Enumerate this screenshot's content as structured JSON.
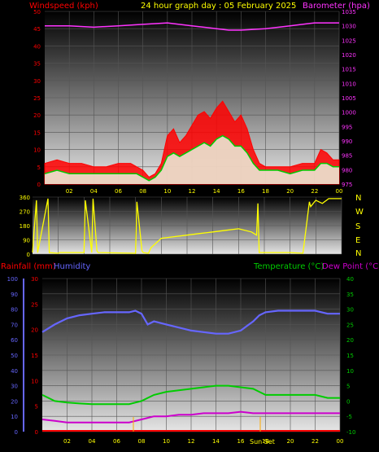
{
  "header": {
    "windspeed_label": "Windspeed (kph)",
    "title": "24 hour graph day : 05 February 2025",
    "barometer_label": "Barometer (hpa)"
  },
  "lower_header": {
    "rain_label": "Rainfall (mm)",
    "humidity_label": "Humidity",
    "temp_label": "Temperature (°C)",
    "dew_label": "Dew Point (°C)"
  },
  "compass": [
    "N",
    "W",
    "S",
    "E",
    "N"
  ],
  "sun_label": "Sun Set",
  "colors": {
    "windspeed": "#ff0000",
    "wind_avg": "#00cc00",
    "gust": "#e8ffe8",
    "barometer": "#ff33ff",
    "direction": "#ffff00",
    "humidity": "#6666ff",
    "temperature": "#00cc00",
    "dew_point": "#cc00cc",
    "rain": "#ff0000",
    "tick_text": "#ffff00"
  },
  "chart_data": [
    {
      "type": "line",
      "id": "wind",
      "x_tick_labels": [
        "02",
        "04",
        "06",
        "08",
        "10",
        "12",
        "14",
        "16",
        "18",
        "20",
        "22",
        "00"
      ],
      "y_left_ticks": [
        "0",
        "5",
        "10",
        "15",
        "20",
        "25",
        "30",
        "35",
        "40",
        "45",
        "50"
      ],
      "ylim_left": [
        0,
        50
      ],
      "y_right_ticks": [
        "975",
        "980",
        "985",
        "990",
        "995",
        "1000",
        "1005",
        "1010",
        "1015",
        "1020",
        "1025",
        "1030",
        "1035"
      ],
      "ylim_right": [
        975,
        1035
      ],
      "xlim_hours": [
        0,
        24
      ],
      "series": [
        {
          "key": "gust",
          "hours": [
            0,
            1,
            2,
            3,
            4,
            5,
            6,
            7,
            7.5,
            8,
            8.5,
            9,
            9.5,
            10,
            10.5,
            11,
            11.5,
            12,
            12.5,
            13,
            13.5,
            14,
            14.5,
            15,
            15.5,
            16,
            16.5,
            17,
            17.5,
            18,
            19,
            20,
            21,
            22,
            22.5,
            23,
            23.5,
            24
          ],
          "values": [
            6,
            7,
            6,
            6,
            5,
            5,
            6,
            6,
            5,
            4,
            2,
            3,
            6,
            14,
            16,
            12,
            14,
            17,
            20,
            21,
            19,
            22,
            24,
            21,
            18,
            20,
            16,
            10,
            6,
            5,
            5,
            5,
            6,
            6,
            10,
            9,
            7,
            7
          ]
        },
        {
          "key": "wind_avg",
          "hours": [
            0,
            1,
            2,
            3,
            4,
            5,
            6,
            7,
            7.5,
            8,
            8.5,
            9,
            9.5,
            10,
            10.5,
            11,
            11.5,
            12,
            12.5,
            13,
            13.5,
            14,
            14.5,
            15,
            15.5,
            16,
            16.5,
            17,
            17.5,
            18,
            19,
            20,
            21,
            22,
            22.5,
            23,
            23.5,
            24
          ],
          "values": [
            3,
            4,
            3,
            3,
            3,
            3,
            3,
            3,
            3,
            2,
            1,
            2,
            4,
            8,
            9,
            8,
            9,
            10,
            11,
            12,
            11,
            13,
            14,
            13,
            11,
            11,
            9,
            6,
            4,
            4,
            4,
            3,
            4,
            4,
            6,
            6,
            5,
            5
          ]
        },
        {
          "key": "barometer",
          "hours": [
            0,
            2,
            4,
            6,
            8,
            10,
            12,
            14,
            15,
            16,
            18,
            20,
            22,
            24
          ],
          "values": [
            1030,
            1030,
            1029.5,
            1030,
            1030.5,
            1031,
            1030,
            1029,
            1028.5,
            1028.5,
            1029,
            1030,
            1031,
            1031
          ]
        }
      ]
    },
    {
      "type": "line",
      "id": "direction",
      "y_ticks": [
        "0",
        "90",
        "180",
        "270",
        "360"
      ],
      "ylim": [
        0,
        360
      ],
      "xlim_hours": [
        0,
        24
      ],
      "series": [
        {
          "key": "direction",
          "hours": [
            0,
            0.3,
            0.4,
            1.2,
            1.3,
            2.0,
            2.1,
            4.0,
            4.1,
            4.6,
            4.7,
            5.0,
            5.1,
            8.0,
            8.1,
            8.5,
            8.6,
            9.0,
            9.2,
            10,
            11,
            12,
            13,
            14,
            15,
            16,
            17,
            17.4,
            17.5,
            17.6,
            18,
            19,
            20,
            21,
            21.5,
            21.6,
            22,
            22.5,
            23,
            23.5,
            24
          ],
          "values": [
            10,
            340,
            10,
            350,
            10,
            5,
            10,
            10,
            340,
            10,
            350,
            20,
            10,
            5,
            330,
            20,
            10,
            5,
            40,
            100,
            110,
            120,
            130,
            140,
            150,
            160,
            140,
            120,
            320,
            10,
            10,
            10,
            10,
            5,
            330,
            300,
            340,
            320,
            350,
            350,
            350
          ]
        }
      ]
    },
    {
      "type": "line",
      "id": "weather",
      "y_left_humidity_ticks": [
        "0",
        "10",
        "20",
        "30",
        "40",
        "50",
        "60",
        "70",
        "80",
        "90",
        "100"
      ],
      "ylim_humidity": [
        0,
        100
      ],
      "y_left_rain_ticks": [
        "0",
        "5",
        "10",
        "15",
        "20",
        "25",
        "30"
      ],
      "ylim_rain": [
        0,
        30
      ],
      "y_right_temp_ticks": [
        "-10",
        "-5",
        "0",
        "5",
        "10",
        "15",
        "20",
        "25",
        "30",
        "35",
        "40"
      ],
      "ylim_temp": [
        -10,
        40
      ],
      "x_tick_labels": [
        "02",
        "04",
        "06",
        "08",
        "10",
        "12",
        "14",
        "16",
        "18",
        "20",
        "22",
        "00"
      ],
      "xlim_hours": [
        0,
        24
      ],
      "series": [
        {
          "key": "humidity",
          "hours": [
            0,
            1,
            2,
            3,
            4,
            5,
            6,
            7,
            7.5,
            8,
            8.5,
            9,
            10,
            11,
            12,
            13,
            14,
            15,
            16,
            16.5,
            17,
            17.5,
            18,
            19,
            20,
            21,
            22,
            23,
            24
          ],
          "values": [
            65,
            70,
            74,
            76,
            77,
            78,
            78,
            78,
            79,
            77,
            70,
            72,
            70,
            68,
            66,
            65,
            64,
            64,
            66,
            69,
            72,
            76,
            78,
            79,
            79,
            79,
            79,
            77,
            77
          ]
        },
        {
          "key": "temperature",
          "hours": [
            0,
            1,
            2,
            3,
            4,
            5,
            6,
            7,
            7.5,
            8,
            8.5,
            9,
            10,
            11,
            12,
            13,
            14,
            15,
            16,
            17,
            17.5,
            18,
            19,
            20,
            21,
            22,
            23,
            24
          ],
          "values": [
            2,
            0,
            -0.5,
            -0.8,
            -1,
            -1,
            -1,
            -1,
            -0.5,
            0,
            1,
            2,
            3,
            3.5,
            4,
            4.5,
            5,
            5,
            4.5,
            4,
            3,
            2,
            2,
            2,
            2,
            2,
            1,
            1
          ]
        },
        {
          "key": "dew_point",
          "hours": [
            0,
            1,
            2,
            3,
            4,
            5,
            6,
            7,
            8,
            8.5,
            9,
            10,
            11,
            12,
            13,
            14,
            15,
            16,
            17,
            18,
            19,
            20,
            21,
            22,
            23,
            24
          ],
          "values": [
            -6,
            -6.5,
            -7,
            -7,
            -7,
            -7,
            -7,
            -7,
            -6,
            -5.5,
            -5,
            -5,
            -4.5,
            -4.5,
            -4,
            -4,
            -4,
            -3.5,
            -4,
            -4,
            -4,
            -4,
            -4,
            -4,
            -4,
            -4
          ]
        },
        {
          "key": "rain",
          "hours": [
            0,
            24
          ],
          "values": [
            0,
            0
          ]
        }
      ]
    }
  ]
}
